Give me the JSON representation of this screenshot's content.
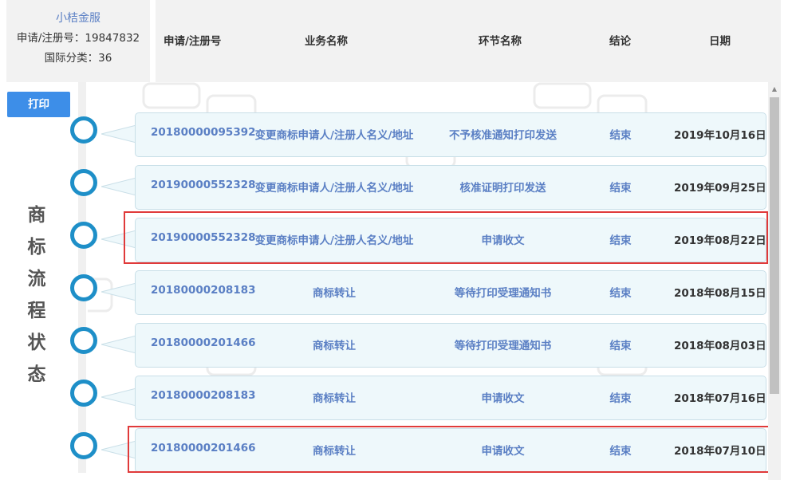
{
  "info": {
    "brand": "小桔金服",
    "reg_line": "申请/注册号：19847832",
    "class_line": "国际分类：36"
  },
  "header": {
    "columns": [
      "申请/注册号",
      "业务名称",
      "环节名称",
      "结论",
      "日期"
    ]
  },
  "print_button": "打印",
  "side_title": [
    "商",
    "标",
    "流",
    "程",
    "状",
    "态"
  ],
  "rows": [
    {
      "reg_no": "20180000095392",
      "business": "变更商标申请人/注册人名义/地址",
      "step": "不予核准通知打印发送",
      "result": "结束",
      "date": "2019年10月16日",
      "highlighted": false
    },
    {
      "reg_no": "20190000552328",
      "business": "变更商标申请人/注册人名义/地址",
      "step": "核准证明打印发送",
      "result": "结束",
      "date": "2019年09月25日",
      "highlighted": false
    },
    {
      "reg_no": "20190000552328",
      "business": "变更商标申请人/注册人名义/地址",
      "step": "申请收文",
      "result": "结束",
      "date": "2019年08月22日",
      "highlighted": true
    },
    {
      "reg_no": "20180000208183",
      "business": "商标转让",
      "step": "等待打印受理通知书",
      "result": "结束",
      "date": "2018年08月15日",
      "highlighted": false
    },
    {
      "reg_no": "20180000201466",
      "business": "商标转让",
      "step": "等待打印受理通知书",
      "result": "结束",
      "date": "2018年08月03日",
      "highlighted": false
    },
    {
      "reg_no": "20180000208183",
      "business": "商标转让",
      "step": "申请收文",
      "result": "结束",
      "date": "2018年07月16日",
      "highlighted": false
    },
    {
      "reg_no": "20180000201466",
      "business": "商标转让",
      "step": "申请收文",
      "result": "结束",
      "date": "2018年07月10日",
      "highlighted": true
    }
  ],
  "colors": {
    "accent": "#1e8fc8",
    "link": "#5a7fc4",
    "button": "#3d8ee8",
    "highlight": "#e03a3a",
    "bubble": "#eef8fb"
  }
}
